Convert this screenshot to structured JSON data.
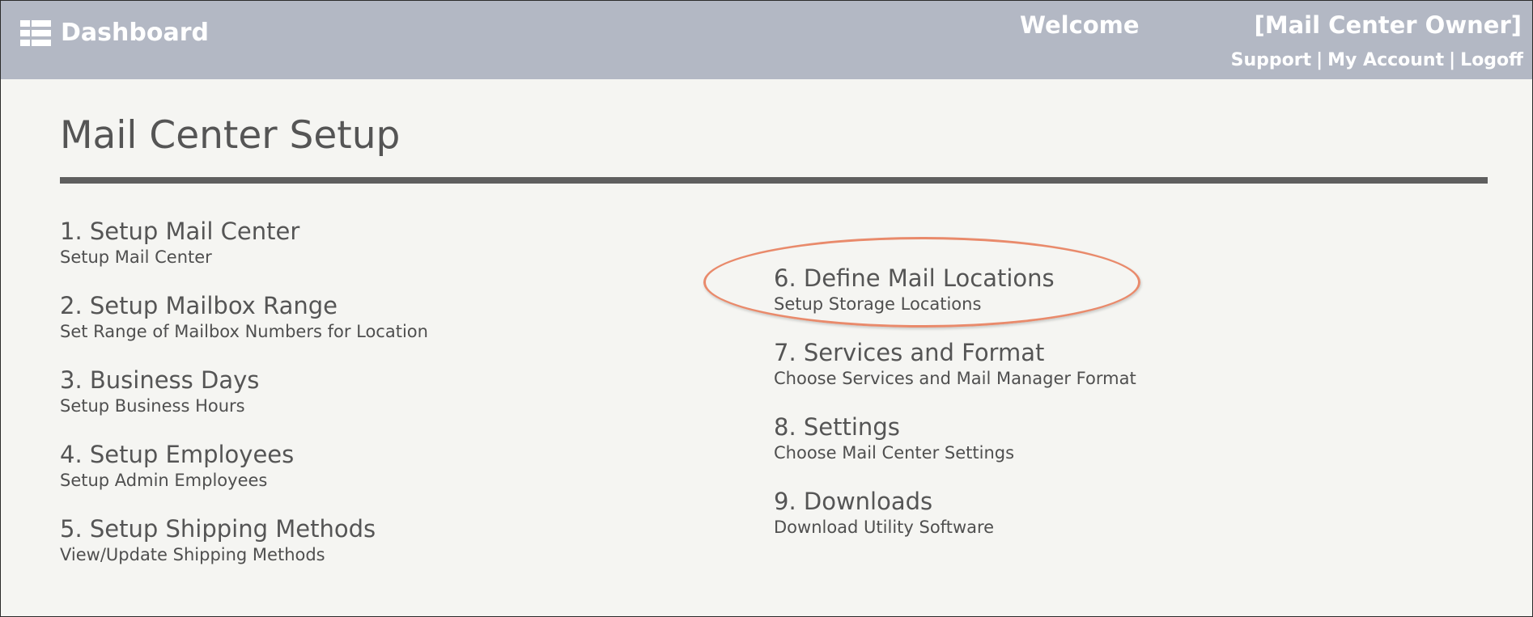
{
  "header": {
    "brand_label": "Dashboard",
    "welcome_label": "Welcome",
    "user_role": "[Mail Center Owner]",
    "links": {
      "support": "Support",
      "my_account": "My Account",
      "logoff": "Logoff",
      "separator": "|"
    }
  },
  "main": {
    "title": "Mail Center Setup",
    "steps": [
      {
        "title": "1. Setup Mail Center",
        "description": "Setup Mail Center"
      },
      {
        "title": "2. Setup Mailbox Range",
        "description": "Set Range of Mailbox Numbers for Location"
      },
      {
        "title": "3. Business Days",
        "description": "Setup Business Hours"
      },
      {
        "title": "4. Setup Employees",
        "description": "Setup Admin Employees"
      },
      {
        "title": "5. Setup Shipping Methods",
        "description": "View/Update Shipping Methods"
      },
      {
        "title": "6. Define Mail Locations",
        "description": "Setup Storage Locations"
      },
      {
        "title": "7. Services and Format",
        "description": "Choose Services and Mail Manager Format"
      },
      {
        "title": "8. Settings",
        "description": "Choose Mail Center Settings"
      },
      {
        "title": "9. Downloads",
        "description": "Download Utility Software"
      }
    ]
  },
  "annotation": {
    "highlighted_step": "6. Define Mail Locations",
    "color": "#e98a6b"
  },
  "colors": {
    "header_bg": "#b3b8c4",
    "page_bg": "#f5f5f2",
    "text": "#555555",
    "rule": "#5f5f5f"
  }
}
